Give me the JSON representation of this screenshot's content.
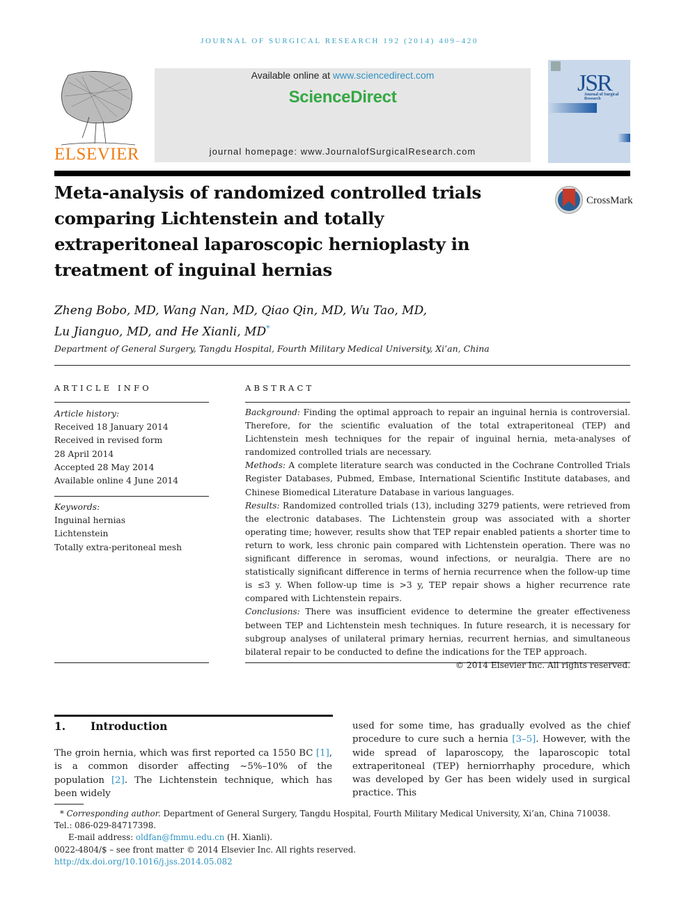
{
  "running_head": "Journal of Surgical Research 192 (2014) 409–420",
  "header": {
    "publisher_logo_label": "ELSEVIER",
    "available_online_prefix": "Available online at ",
    "available_online_link": "www.sciencedirect.com",
    "platform_name": "ScienceDirect",
    "journal_homepage": "journal homepage: www.JournalofSurgicalResearch.com",
    "cover": {
      "title_letters": "JSR",
      "subtitle": "Journal of Surgical Research"
    },
    "crossmark_label": "CrossMark"
  },
  "article": {
    "title": "Meta-analysis of randomized controlled trials comparing Lichtenstein and totally extraperitoneal laparoscopic hernioplasty in treatment of inguinal hernias",
    "authors_line1": "Zheng Bobo, MD, Wang Nan, MD, Qiao Qin, MD, Wu Tao, MD,",
    "authors_line2": "Lu Jianguo, MD, and He Xianli, MD",
    "corresponding_mark": "*",
    "affiliation": "Department of General Surgery, Tangdu Hospital, Fourth Military Medical University, Xi’an, China"
  },
  "article_info": {
    "heading": "ARTICLE INFO",
    "history_label": "Article history:",
    "history": [
      "Received 18 January 2014",
      "Received in revised form",
      "28 April 2014",
      "Accepted 28 May 2014",
      "Available online 4 June 2014"
    ],
    "keywords_label": "Keywords:",
    "keywords": [
      "Inguinal hernias",
      "Lichtenstein",
      "Totally extra-peritoneal mesh"
    ]
  },
  "abstract": {
    "heading": "ABSTRACT",
    "sections": [
      {
        "label": "Background:",
        "text": " Finding the optimal approach to repair an inguinal hernia is controversial. Therefore, for the scientific evaluation of the total extraperitoneal (TEP) and Lichtenstein mesh techniques for the repair of inguinal hernia, meta-analyses of randomized controlled trials are necessary."
      },
      {
        "label": "Methods:",
        "text": " A complete literature search was conducted in the Cochrane Controlled Trials Register Databases, Pubmed, Embase, International Scientific Institute databases, and Chinese Biomedical Literature Database in various languages."
      },
      {
        "label": "Results:",
        "text": " Randomized controlled trials (13), including 3279 patients, were retrieved from the electronic databases. The Lichtenstein group was associated with a shorter operating time; however, results show that TEP repair enabled patients a shorter time to return to work, less chronic pain compared with Lichtenstein operation. There was no significant difference in seromas, wound infections, or neuralgia. There are no statistically significant difference in terms of hernia recurrence when the follow-up time is ≤3 y. When follow-up time is >3 y, TEP repair shows a higher recurrence rate compared with Lichtenstein repairs."
      },
      {
        "label": "Conclusions:",
        "text": " There was insufficient evidence to determine the greater effectiveness between TEP and Lichtenstein mesh techniques. In future research, it is necessary for subgroup analyses of unilateral primary hernias, recurrent hernias, and simultaneous bilateral repair to be conducted to define the indications for the TEP approach."
      }
    ],
    "copyright": "© 2014 Elsevier Inc. All rights reserved."
  },
  "introduction": {
    "number": "1.",
    "heading": "Introduction",
    "col1": {
      "t1": "The groin hernia, which was first reported ca 1550 BC ",
      "r1": "[1]",
      "t2": ", is a common disorder affecting ~5%–10% of the population ",
      "r2": "[2]",
      "t3": ". The Lichtenstein technique, which has been widely"
    },
    "col2": {
      "t1": "used for some time, has gradually evolved as the chief procedure to cure such a hernia ",
      "r1": "[3–5]",
      "t2": ". However, with the wide spread of laparoscopy, the laparoscopic total extraperitoneal (TEP) herniorrhaphy procedure, which was developed by Ger has been widely used in surgical practice. This"
    }
  },
  "footnotes": {
    "corresponding_label": "* Corresponding author.",
    "corresponding_text": " Department of General Surgery, Tangdu Hospital, Fourth Military Medical University, Xi’an, China 710038. Tel.: 086-029-84717398.",
    "email_label": "E-mail address: ",
    "email": "oldfan@fmmu.edu.cn",
    "email_suffix": " (H. Xianli).",
    "front_matter": "0022-4804/$ – see front matter © 2014 Elsevier Inc. All rights reserved.",
    "doi": "http://dx.doi.org/10.1016/j.jss.2014.05.082"
  }
}
